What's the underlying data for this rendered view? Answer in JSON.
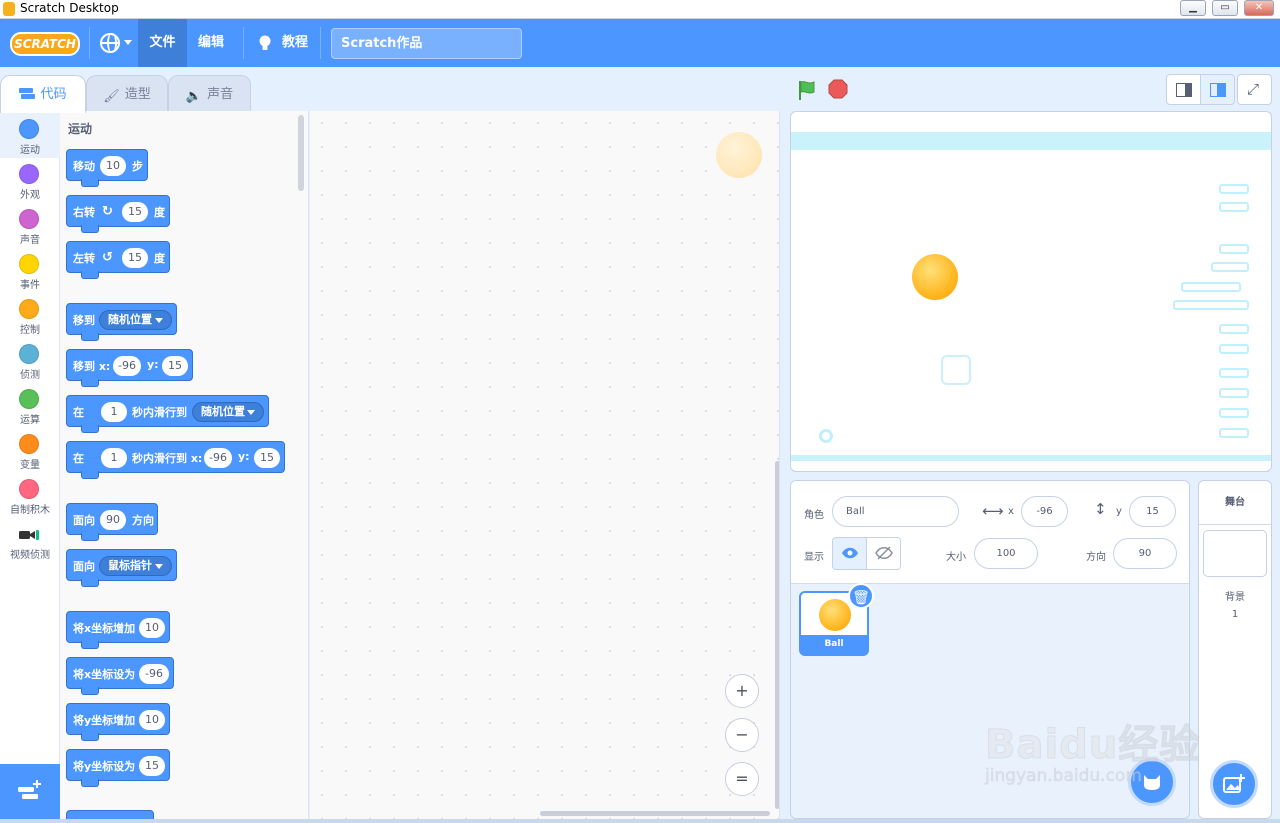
{
  "window": {
    "title": "Scratch Desktop",
    "controls": [
      "minimize-icon",
      "maximize-icon",
      "close-icon"
    ]
  },
  "menubar": {
    "logo": "SCRATCH",
    "file": "文件",
    "edit": "编辑",
    "tutorials": "教程",
    "project_title": "Scratch作品"
  },
  "tabs": [
    {
      "label": "代码",
      "icon": "code-icon",
      "active": true
    },
    {
      "label": "造型",
      "icon": "brush-icon",
      "active": false
    },
    {
      "label": "声音",
      "icon": "speaker-icon",
      "active": false
    }
  ],
  "categories": [
    {
      "label": "运动",
      "color": "#4c97ff"
    },
    {
      "label": "外观",
      "color": "#9966ff"
    },
    {
      "label": "声音",
      "color": "#cf63cf"
    },
    {
      "label": "事件",
      "color": "#ffd500"
    },
    {
      "label": "控制",
      "color": "#ffab19"
    },
    {
      "label": "侦测",
      "color": "#5cb1d6"
    },
    {
      "label": "运算",
      "color": "#59c059"
    },
    {
      "label": "变量",
      "color": "#ff8c1a"
    },
    {
      "label": "自制积木",
      "color": "#ff6680"
    },
    {
      "label": "视频侦测",
      "color": "#0fbd8c"
    }
  ],
  "palette": {
    "heading": "运动",
    "blocks": {
      "move": {
        "a": "移动",
        "v": "10",
        "b": "步"
      },
      "turn_right": {
        "a": "右转",
        "v": "15",
        "b": "度"
      },
      "turn_left": {
        "a": "左转",
        "v": "15",
        "b": "度"
      },
      "goto_random": {
        "a": "移到",
        "dd": "随机位置"
      },
      "goto_xy": {
        "a": "移到 x:",
        "x": "-96",
        "b": "y:",
        "y": "15"
      },
      "glide_random": {
        "a": "在",
        "v": "1",
        "b": "秒内滑行到",
        "dd": "随机位置"
      },
      "glide_xy": {
        "a": "在",
        "v": "1",
        "b": "秒内滑行到 x:",
        "x": "-96",
        "c": "y:",
        "y": "15"
      },
      "point_dir": {
        "a": "面向",
        "v": "90",
        "b": "方向"
      },
      "point_towards": {
        "a": "面向",
        "dd": "鼠标指针"
      },
      "change_x": {
        "a": "将x坐标增加",
        "v": "10"
      },
      "set_x": {
        "a": "将x坐标设为",
        "v": "-96"
      },
      "change_y": {
        "a": "将y坐标增加",
        "v": "10"
      },
      "set_y": {
        "a": "将y坐标设为",
        "v": "15"
      }
    }
  },
  "zoom": {
    "in": "+",
    "out": "−",
    "reset": "="
  },
  "sprite_info": {
    "sprite_label": "角色",
    "sprite_name": "Ball",
    "x_label": "x",
    "x_value": "-96",
    "y_label": "y",
    "y_value": "15",
    "show_label": "显示",
    "size_label": "大小",
    "size_value": "100",
    "direction_label": "方向",
    "direction_value": "90"
  },
  "sprite_list": [
    {
      "name": "Ball",
      "selected": true
    }
  ],
  "stage_pane": {
    "title": "舞台",
    "backdrops_label": "背景",
    "backdrops_count": "1"
  },
  "watermark": {
    "logo": "Baidu经验",
    "url": "jingyan.baidu.com"
  }
}
